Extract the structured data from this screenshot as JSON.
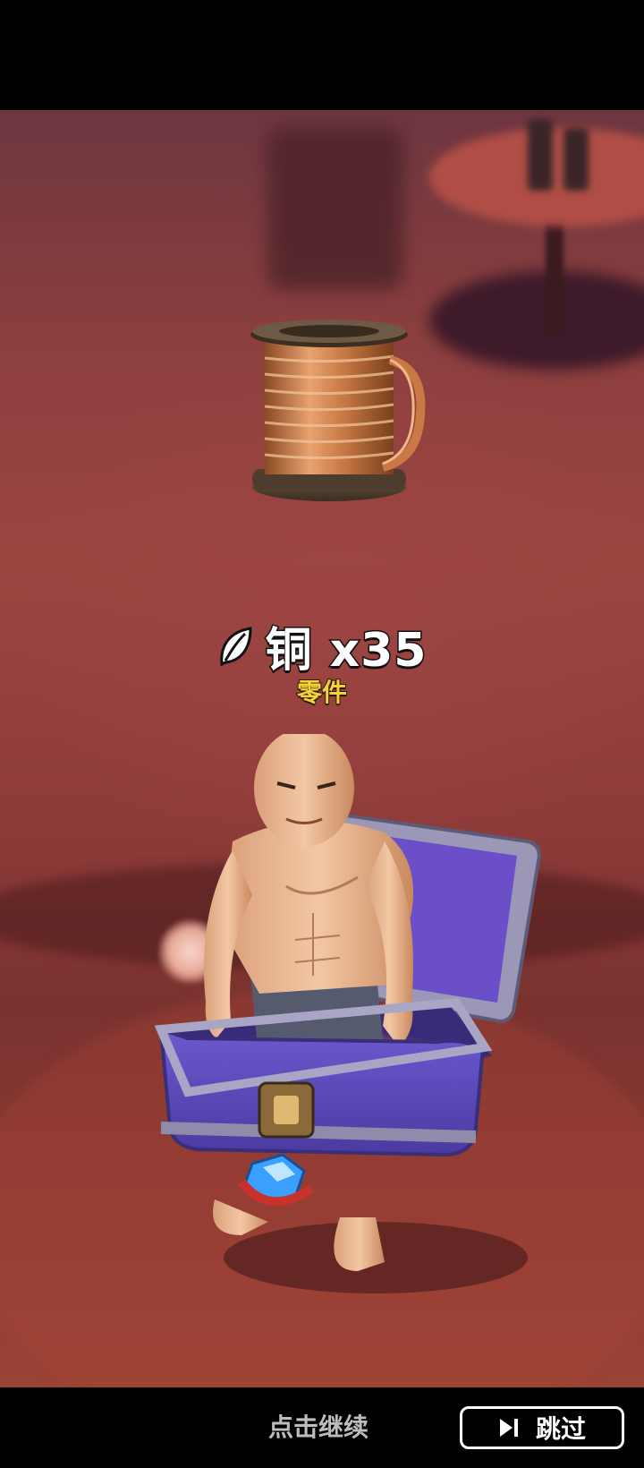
{
  "reward": {
    "item_name": "铜 x35",
    "item_category": "零件",
    "item_icon": "copper-wire-spool",
    "rarity_icon": "leaf-icon",
    "category_color": "#f6d23a"
  },
  "scene": {
    "character": "bald-muscular-man-in-chest",
    "container": "purple-treasure-chest",
    "gem": "blue-gem"
  },
  "footer": {
    "continue_label": "点击继续",
    "skip_label": "跳过",
    "skip_icon": "skip-forward-icon"
  }
}
